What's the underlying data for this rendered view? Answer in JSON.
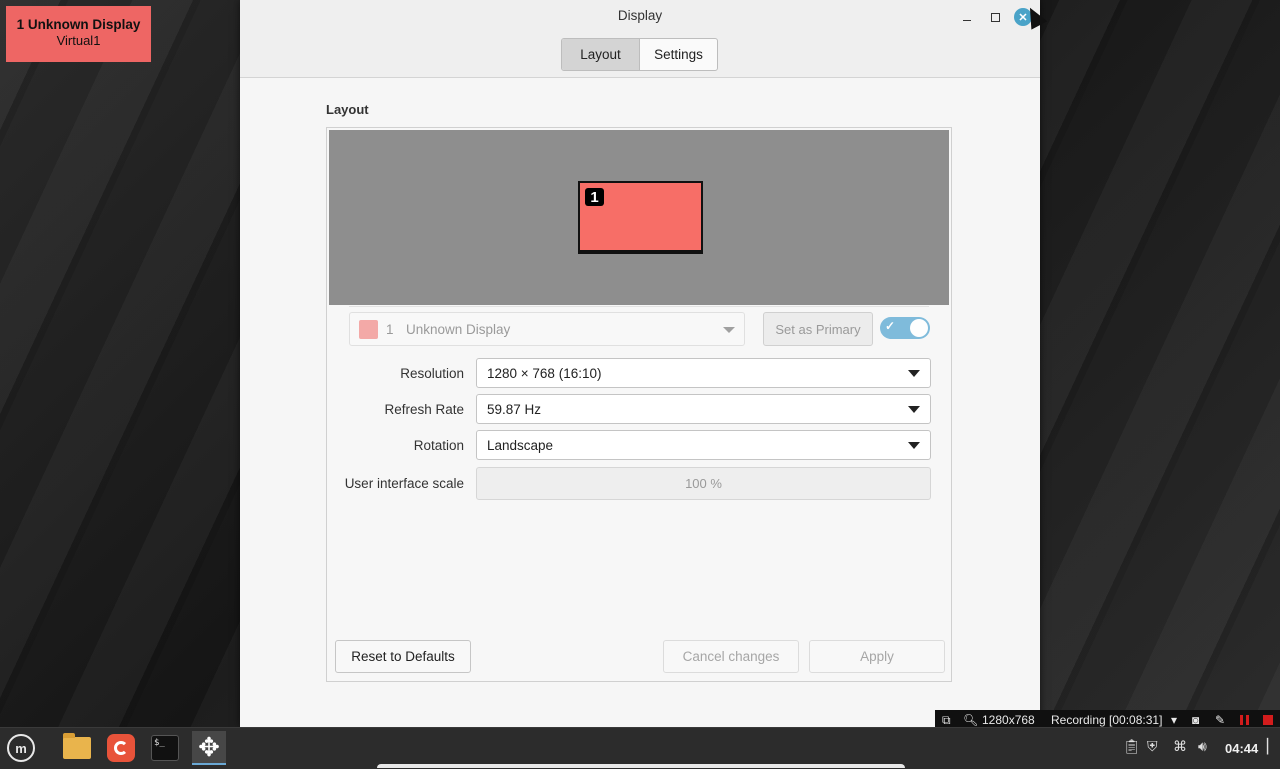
{
  "osd": {
    "line1": "1  Unknown Display",
    "line2": "Virtual1"
  },
  "window": {
    "title": "Display",
    "tabs": [
      {
        "label": "Layout",
        "active": true
      },
      {
        "label": "Settings",
        "active": false
      }
    ],
    "section_label": "Layout",
    "monitor_number": "1",
    "display_select": {
      "number": "1",
      "name": "Unknown Display",
      "swatch_color": "#f3a9a7"
    },
    "set_primary_label": "Set as Primary",
    "enabled_toggle": true,
    "settings": {
      "resolution_label": "Resolution",
      "resolution_value": "1280 × 768 (16:10)",
      "refresh_label": "Refresh Rate",
      "refresh_value": "59.87 Hz",
      "rotation_label": "Rotation",
      "rotation_value": "Landscape",
      "scale_label": "User interface scale",
      "scale_value": "100 %"
    },
    "buttons": {
      "reset": "Reset to Defaults",
      "cancel": "Cancel changes",
      "apply": "Apply"
    }
  },
  "recorder": {
    "resolution": "1280x768",
    "status": "Recording [00:08:31]"
  },
  "taskbar": {
    "clock": "04:44",
    "items": [
      "menu-icon",
      "files-icon",
      "firefox-icon",
      "terminal-icon",
      "display-move-icon"
    ]
  },
  "colors": {
    "monitor_fill": "#f76e67",
    "accent": "#79b8da",
    "osd_bg": "#ee6664"
  }
}
